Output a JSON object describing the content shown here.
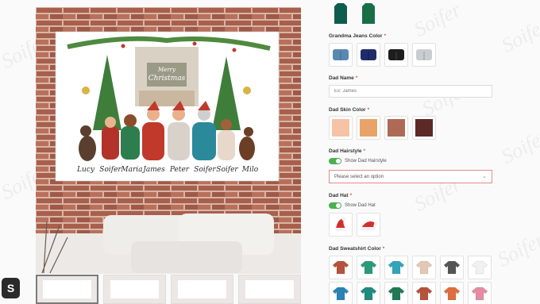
{
  "watermark_text": "Soifer",
  "product_image": {
    "greeting_line1": "Merry",
    "greeting_line2": "Christmas",
    "names": [
      "Lucy",
      "Soifer",
      "Maria",
      "James",
      "Peter",
      "Soifer",
      "Soifer",
      "Milo"
    ]
  },
  "thumbnails": [
    {
      "label": ""
    },
    {
      "label": ""
    },
    {
      "label": ""
    },
    {
      "label": ""
    }
  ],
  "shop_badge": "S",
  "panel": {
    "top_swatches": [
      {
        "color": "#0e5c4d"
      },
      {
        "color": "#1a6e46"
      }
    ],
    "grandma_jeans": {
      "label": "Grandma Jeans Color",
      "required": "*",
      "options": [
        {
          "color": "#5b88b0"
        },
        {
          "color": "#1f2c6b"
        },
        {
          "color": "#1d1d1d"
        },
        {
          "color": "#c9cdd2"
        }
      ]
    },
    "dad_name": {
      "label": "Dad Name",
      "required": "*",
      "placeholder": "Ex: James"
    },
    "dad_skin": {
      "label": "Dad Skin Color",
      "required": "*",
      "options": [
        {
          "color": "#f6c3a7"
        },
        {
          "color": "#e8a36a"
        },
        {
          "color": "#ae6a56"
        },
        {
          "color": "#5c2a26"
        }
      ]
    },
    "dad_hairstyle": {
      "label": "Dad Hairstyle",
      "required": "*",
      "toggle_label": "Show Dad Hairstyle",
      "select_placeholder": "Please select an option"
    },
    "dad_hat": {
      "label": "Dad Hat",
      "required": "*",
      "toggle_label": "Show Dad Hat",
      "options": [
        {
          "icon": "santa-hat-icon"
        },
        {
          "icon": "santa-hat-icon"
        }
      ]
    },
    "dad_sweatshirt": {
      "label": "Dad Sweatshirt Color",
      "required": "*",
      "row1": [
        {
          "color": "#b5533c"
        },
        {
          "color": "#2b9a7a"
        },
        {
          "color": "#32a5b8"
        },
        {
          "color": "#e2c7b5"
        },
        {
          "color": "#555555"
        },
        {
          "color": "#f1f1f1"
        }
      ],
      "row2": [
        {
          "color": "#2a83b5"
        },
        {
          "color": "#1f8a80"
        },
        {
          "color": "#1f7a55"
        },
        {
          "color": "#b5533c"
        },
        {
          "color": "#e06d3f"
        },
        {
          "color": "#e58ba3"
        }
      ]
    }
  }
}
